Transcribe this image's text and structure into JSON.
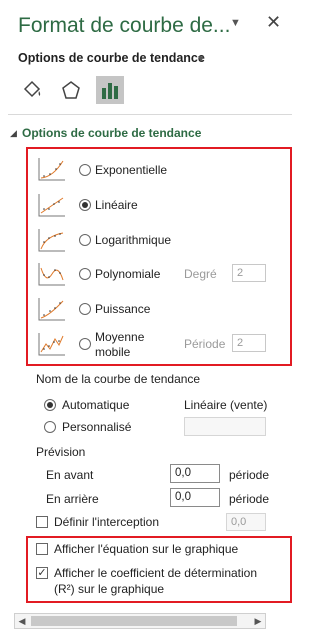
{
  "pane": {
    "title": "Format de courbe de...",
    "subheader": "Options de courbe de tendance",
    "section_title": "Options de courbe de tendance"
  },
  "icons": {
    "title_dropdown": "chevron-down-icon",
    "close": "close-icon",
    "subheader_dropdown": "chevron-down-icon",
    "tab_fill": "paint-bucket-icon",
    "tab_effects": "pentagon-icon",
    "tab_options": "bar-chart-icon"
  },
  "trend_types": [
    {
      "label": "Exponentielle",
      "selected": false,
      "icon": "exponential-trend-icon"
    },
    {
      "label": "Linéaire",
      "selected": true,
      "icon": "linear-trend-icon"
    },
    {
      "label": "Logarithmique",
      "selected": false,
      "icon": "logarithmic-trend-icon"
    },
    {
      "label": "Polynomiale",
      "selected": false,
      "icon": "polynomial-trend-icon",
      "param_label": "Degré",
      "param_value": "2"
    },
    {
      "label": "Puissance",
      "selected": false,
      "icon": "power-trend-icon"
    },
    {
      "label_line1": "Moyenne",
      "label_line2": "mobile",
      "selected": false,
      "icon": "moving-average-icon",
      "param_label": "Période",
      "param_value": "2"
    }
  ],
  "trend_name": {
    "heading": "Nom de la courbe de tendance",
    "automatic_label": "Automatique",
    "automatic_value": "Linéaire (vente)",
    "custom_label": "Personnalisé"
  },
  "forecast": {
    "heading": "Prévision",
    "forward_label": "En avant",
    "forward_value": "0,0",
    "backward_label": "En arrière",
    "backward_value": "0,0",
    "unit": "période",
    "intercept_label": "Définir l'interception",
    "intercept_value": "0,0"
  },
  "display": {
    "equation_label": "Afficher l'équation sur le graphique",
    "r2_label_line1": "Afficher le coefficient de détermination",
    "r2_label_line2": "(R²) sur le graphique",
    "equation_checked": false,
    "r2_checked": true
  },
  "colors": {
    "accent_green": "#2e6b44",
    "highlight_red": "#e21b23"
  }
}
